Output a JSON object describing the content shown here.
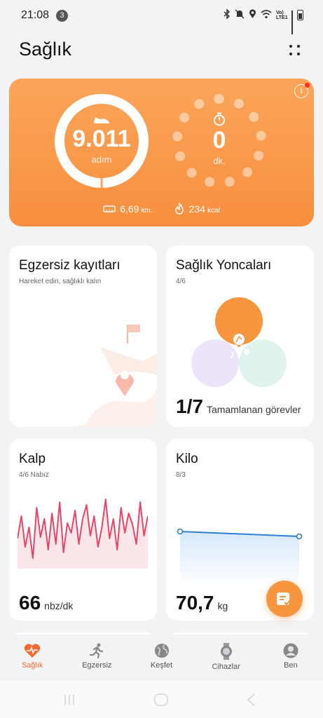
{
  "status_bar": {
    "time": "21:08",
    "notification_count": "3",
    "network_label": "Vo) LTE1"
  },
  "header": {
    "title": "Sağlık"
  },
  "activity": {
    "steps_value": "9.011",
    "steps_unit": "adım",
    "minutes_value": "0",
    "minutes_unit": "dk.",
    "distance_value": "6,69",
    "distance_unit": "km.",
    "calories_value": "234",
    "calories_unit": "kcal",
    "accent_color": "#f88f3e"
  },
  "cards": {
    "exercise": {
      "title": "Egzersiz kayıtları",
      "subtitle": "Hareket edin, sağlıklı kalın"
    },
    "clover": {
      "title": "Sağlık Yoncaları",
      "date": "4/6",
      "completed": "1/7",
      "completed_label": "Tamamlanan görevler"
    },
    "heart": {
      "title": "Kalp",
      "date": "4/6 Nabız",
      "value": "66",
      "unit": "nbz/dk",
      "series": [
        44,
        60,
        38,
        52,
        30,
        66,
        45,
        58,
        36,
        62,
        40,
        70,
        34,
        55,
        48,
        64,
        40,
        58,
        68,
        46,
        60,
        38,
        52,
        72,
        44,
        58,
        36,
        66,
        48,
        62,
        54,
        40,
        70,
        46,
        60
      ]
    },
    "weight": {
      "title": "Kilo",
      "date": "8/3",
      "value": "70,7",
      "unit": "kg"
    }
  },
  "nav": {
    "items": [
      {
        "label": "Sağlık",
        "icon": "heart-pulse-icon",
        "active": true
      },
      {
        "label": "Egzersiz",
        "icon": "runner-icon"
      },
      {
        "label": "Keşfet",
        "icon": "globe-icon"
      },
      {
        "label": "Cihazlar",
        "icon": "watch-icon"
      },
      {
        "label": "Ben",
        "icon": "profile-icon"
      }
    ]
  }
}
